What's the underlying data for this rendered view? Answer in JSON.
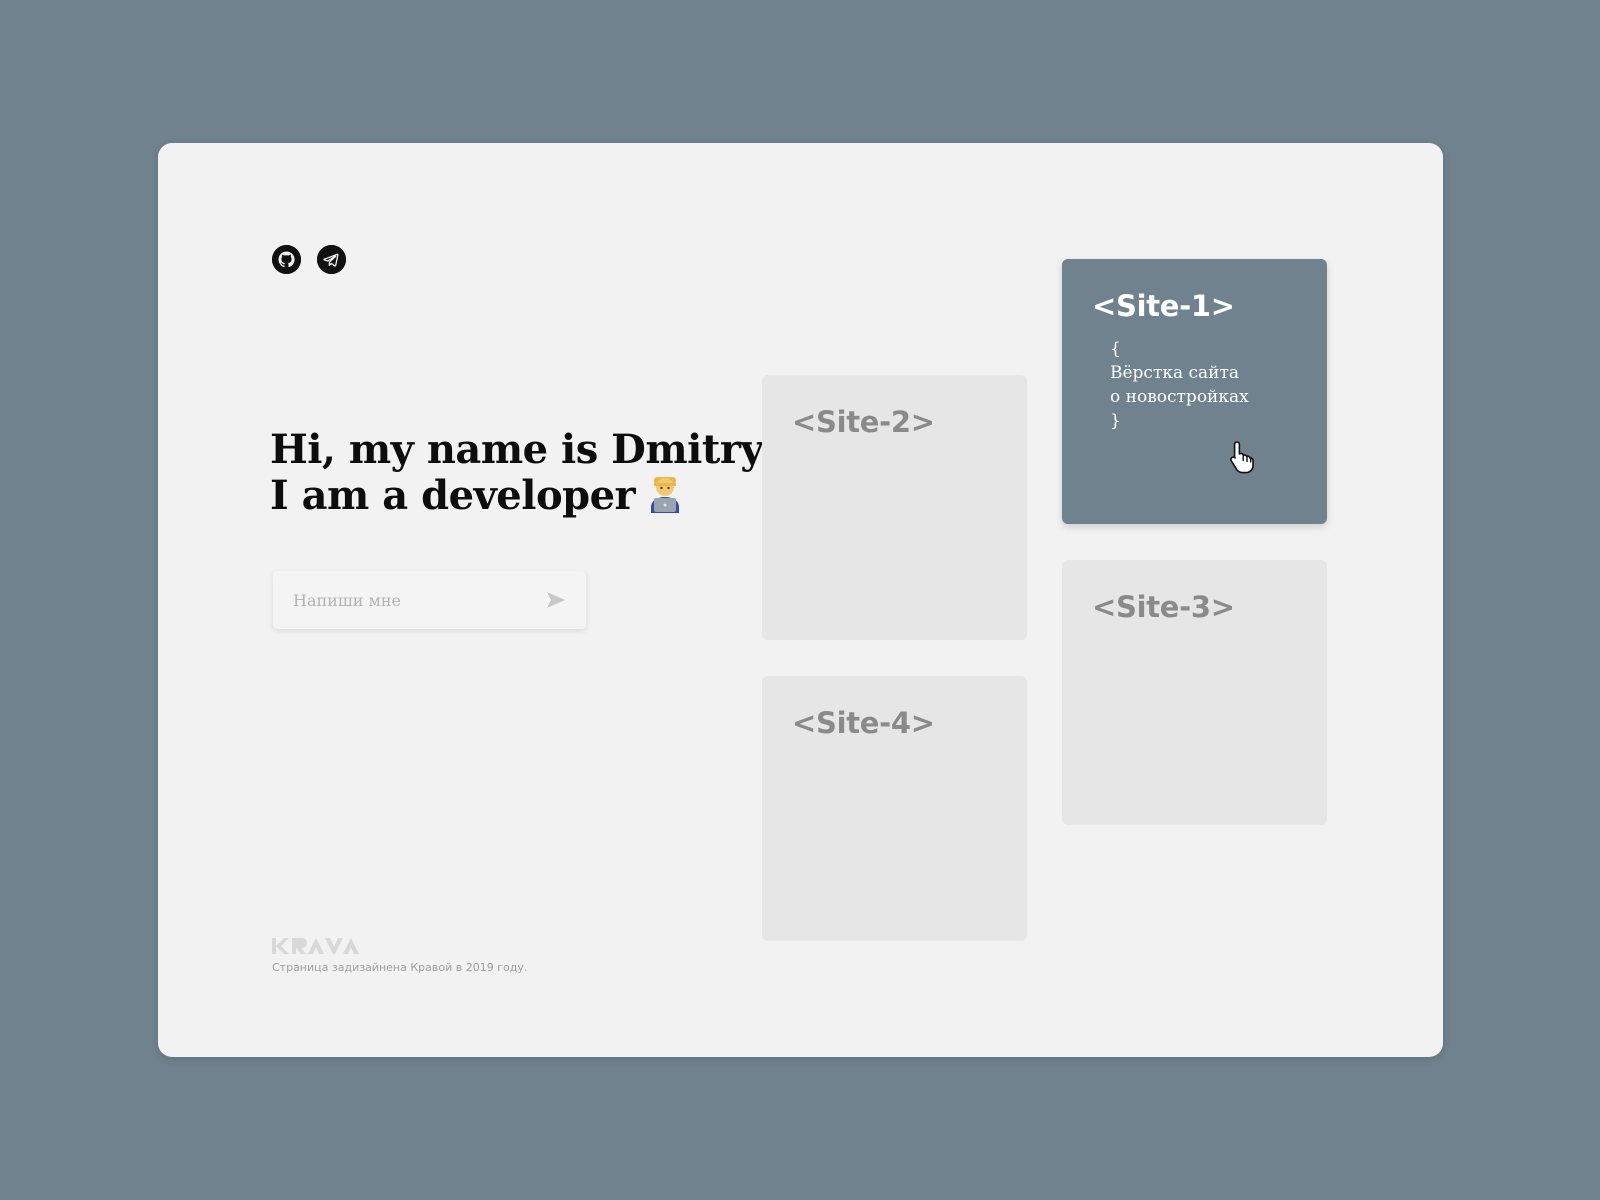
{
  "social": {
    "github": {
      "icon": "github-icon"
    },
    "telegram": {
      "icon": "telegram-icon"
    }
  },
  "hero": {
    "line1": "Hi, my name is Dmitry",
    "line2": "I am a developer",
    "emoji_icon": "man-technologist-icon"
  },
  "message": {
    "placeholder": "Напиши мне",
    "send_icon": "send-arrow-icon"
  },
  "tiles": [
    {
      "title": "<Site-1>",
      "open_brace": "{",
      "desc_line1": "Вёрстка сайта",
      "desc_line2": "о новостройках",
      "close_brace": "}",
      "active": true
    },
    {
      "title": "<Site-2>",
      "active": false
    },
    {
      "title": "<Site-3>",
      "active": false
    },
    {
      "title": "<Site-4>",
      "active": false
    }
  ],
  "footer": {
    "logo": "KRAVA",
    "text": "Страница задизайнена Кравой в 2019 году."
  },
  "colors": {
    "background": "#6f828e",
    "card": "#f2f2f2",
    "tile": "#e6e6e6",
    "tile_active": "#6f828e"
  }
}
